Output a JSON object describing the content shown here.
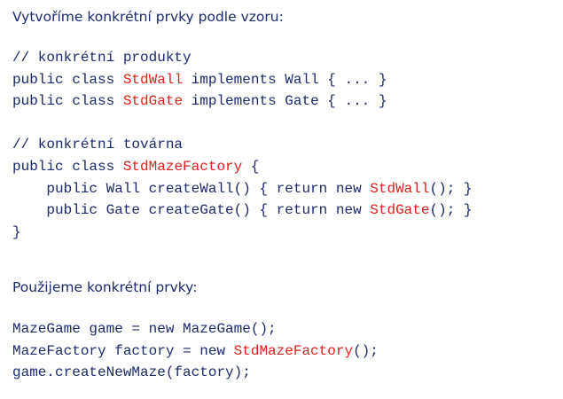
{
  "slide": {
    "intro_text": "Vytvoříme konkrétní prvky podle vzoru:",
    "code_block_1": [
      [
        {
          "t": "// konkrétní produkty"
        }
      ],
      [
        {
          "t": "public class "
        },
        {
          "t": "StdWall",
          "hl": true
        },
        {
          "t": " implements Wall { ... }"
        }
      ],
      [
        {
          "t": "public class "
        },
        {
          "t": "StdGate",
          "hl": true
        },
        {
          "t": " implements Gate { ... }"
        }
      ],
      [],
      [
        {
          "t": "// konkrétní továrna"
        }
      ],
      [
        {
          "t": "public class "
        },
        {
          "t": "StdMazeFactory",
          "hl": true
        },
        {
          "t": " {"
        }
      ],
      [
        {
          "t": "    public Wall createWall() { return new "
        },
        {
          "t": "StdWall",
          "hl": true
        },
        {
          "t": "(); }"
        }
      ],
      [
        {
          "t": "    public Gate createGate() { return new "
        },
        {
          "t": "StdGate",
          "hl": true
        },
        {
          "t": "(); }"
        }
      ],
      [
        {
          "t": "}"
        }
      ]
    ],
    "usage_text": "Použijeme konkrétní prvky:",
    "code_block_2": [
      [
        {
          "t": "MazeGame game = new MazeGame();"
        }
      ],
      [
        {
          "t": "MazeFactory factory = new "
        },
        {
          "t": "StdMazeFactory",
          "hl": true
        },
        {
          "t": "();"
        }
      ],
      [
        {
          "t": "game.createNewMaze(factory);"
        }
      ]
    ]
  },
  "colors": {
    "text": "#1c2a6e",
    "highlight": "#e0201c",
    "background": "#ffffff"
  }
}
